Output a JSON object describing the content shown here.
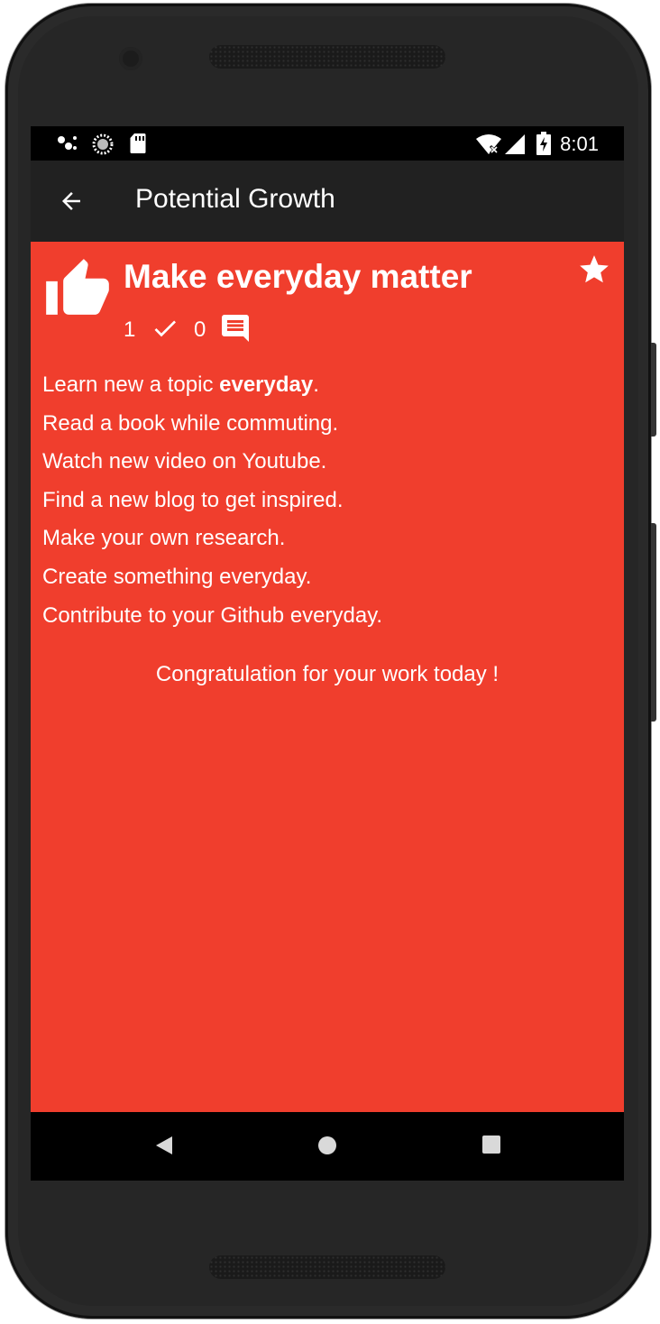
{
  "status_bar": {
    "time": "8:01",
    "icons": [
      "notification-dots-icon",
      "sync-icon",
      "sd-card-icon",
      "wifi-icon",
      "signal-icon",
      "battery-charging-icon"
    ]
  },
  "app_bar": {
    "title": "Potential Growth",
    "back_icon": "arrow-back-icon"
  },
  "card": {
    "title": "Make everyday matter",
    "thumb_icon": "thumb-up-icon",
    "favorite_icon": "star-icon",
    "completed_count": "1",
    "comment_count": "0",
    "lines": [
      {
        "before": "Learn new a topic ",
        "bold": "everyday",
        "after": "."
      },
      {
        "before": "Read a book while commuting.",
        "bold": "",
        "after": ""
      },
      {
        "before": "Watch new video on Youtube.",
        "bold": "",
        "after": ""
      },
      {
        "before": "Find a new blog to get inspired.",
        "bold": "",
        "after": ""
      },
      {
        "before": "Make your own research.",
        "bold": "",
        "after": ""
      },
      {
        "before": "Create something everyday.",
        "bold": "",
        "after": ""
      },
      {
        "before": "Contribute to your Github everyday.",
        "bold": "",
        "after": ""
      }
    ],
    "message": "Congratulation for your work today !"
  },
  "fab": {
    "icon": "comment-icon"
  },
  "nav": {
    "icons": [
      "back-triangle-icon",
      "home-circle-icon",
      "recents-square-icon"
    ]
  },
  "colors": {
    "background": "#f03e2d",
    "app_bar": "#212121",
    "fab": "#00bcc8",
    "text": "#ffffff"
  }
}
